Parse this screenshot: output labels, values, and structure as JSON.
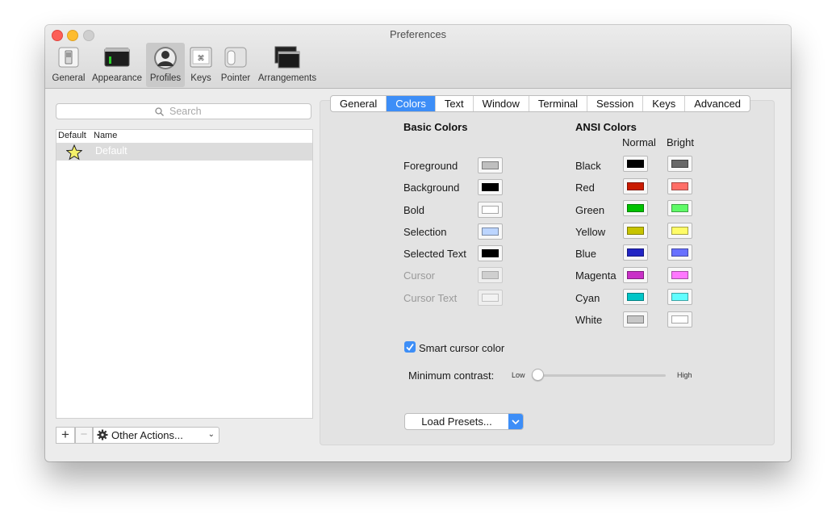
{
  "window": {
    "title": "Preferences"
  },
  "toolbar": {
    "items": [
      {
        "label": "General",
        "icon": "switch-icon"
      },
      {
        "label": "Appearance",
        "icon": "monitor-icon"
      },
      {
        "label": "Profiles",
        "icon": "user-icon",
        "selected": true
      },
      {
        "label": "Keys",
        "icon": "keyboard-icon"
      },
      {
        "label": "Pointer",
        "icon": "mouse-icon"
      },
      {
        "label": "Arrangements",
        "icon": "windows-icon"
      }
    ]
  },
  "sidebar": {
    "search_placeholder": "Search",
    "columns": {
      "default": "Default",
      "name": "Name"
    },
    "profiles": [
      {
        "name": "Default",
        "is_default": true
      }
    ],
    "add_label": "+",
    "remove_label": "−",
    "other_actions_label": "Other Actions..."
  },
  "tabs": [
    "General",
    "Colors",
    "Text",
    "Window",
    "Terminal",
    "Session",
    "Keys",
    "Advanced"
  ],
  "active_tab": "Colors",
  "basic_colors": {
    "title": "Basic Colors",
    "items": [
      {
        "label": "Foreground",
        "color": "#bfbfbf",
        "enabled": true
      },
      {
        "label": "Background",
        "color": "#000000",
        "enabled": true
      },
      {
        "label": "Bold",
        "color": "#ffffff",
        "enabled": true
      },
      {
        "label": "Selection",
        "color": "#bcd5ff",
        "enabled": true
      },
      {
        "label": "Selected Text",
        "color": "#000000",
        "enabled": true
      },
      {
        "label": "Cursor",
        "color": "#c0c0c0",
        "enabled": false
      },
      {
        "label": "Cursor Text",
        "color": "#ffffff",
        "enabled": false
      }
    ]
  },
  "ansi_colors": {
    "title": "ANSI Colors",
    "normal_label": "Normal",
    "bright_label": "Bright",
    "items": [
      {
        "label": "Black",
        "normal": "#000000",
        "bright": "#686868"
      },
      {
        "label": "Red",
        "normal": "#c91b00",
        "bright": "#ff6e67"
      },
      {
        "label": "Green",
        "normal": "#00c200",
        "bright": "#5ffa68"
      },
      {
        "label": "Yellow",
        "normal": "#c7c400",
        "bright": "#fffc67"
      },
      {
        "label": "Blue",
        "normal": "#2225c4",
        "bright": "#6871ff"
      },
      {
        "label": "Magenta",
        "normal": "#c930c7",
        "bright": "#ff77ff"
      },
      {
        "label": "Cyan",
        "normal": "#00c5c7",
        "bright": "#60fdff"
      },
      {
        "label": "White",
        "normal": "#c7c7c7",
        "bright": "#ffffff"
      }
    ]
  },
  "smart_cursor": {
    "label": "Smart cursor color",
    "checked": true
  },
  "contrast": {
    "label": "Minimum contrast:",
    "low": "Low",
    "high": "High",
    "value": 0
  },
  "presets_label": "Load Presets..."
}
